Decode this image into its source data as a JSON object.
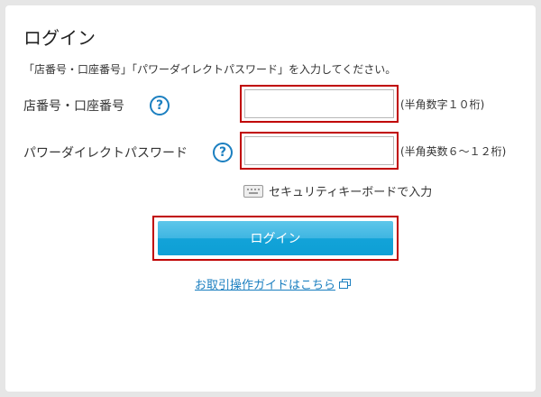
{
  "page": {
    "title": "ログイン",
    "instruction": "「店番号・口座番号」「パワーダイレクトパスワード」を入力してください。"
  },
  "fields": {
    "account": {
      "label": "店番号・口座番号",
      "value": "",
      "placeholder": "",
      "hint": "(半角数字１０桁)",
      "help_icon": "?"
    },
    "password": {
      "label": "パワーダイレクトパスワード",
      "value": "",
      "placeholder": "",
      "hint": "(半角英数６～１２桁)",
      "help_icon": "?"
    }
  },
  "security_keyboard": {
    "icon": "keyboard-icon",
    "label": "セキュリティキーボードで入力"
  },
  "login_button": {
    "label": "ログイン"
  },
  "guide_link": {
    "label": "お取引操作ガイドはこちら",
    "icon": "external-window-icon"
  },
  "colors": {
    "accent": "#1b7fc0",
    "highlight_border": "#c00000",
    "button": "#12a3d8"
  }
}
